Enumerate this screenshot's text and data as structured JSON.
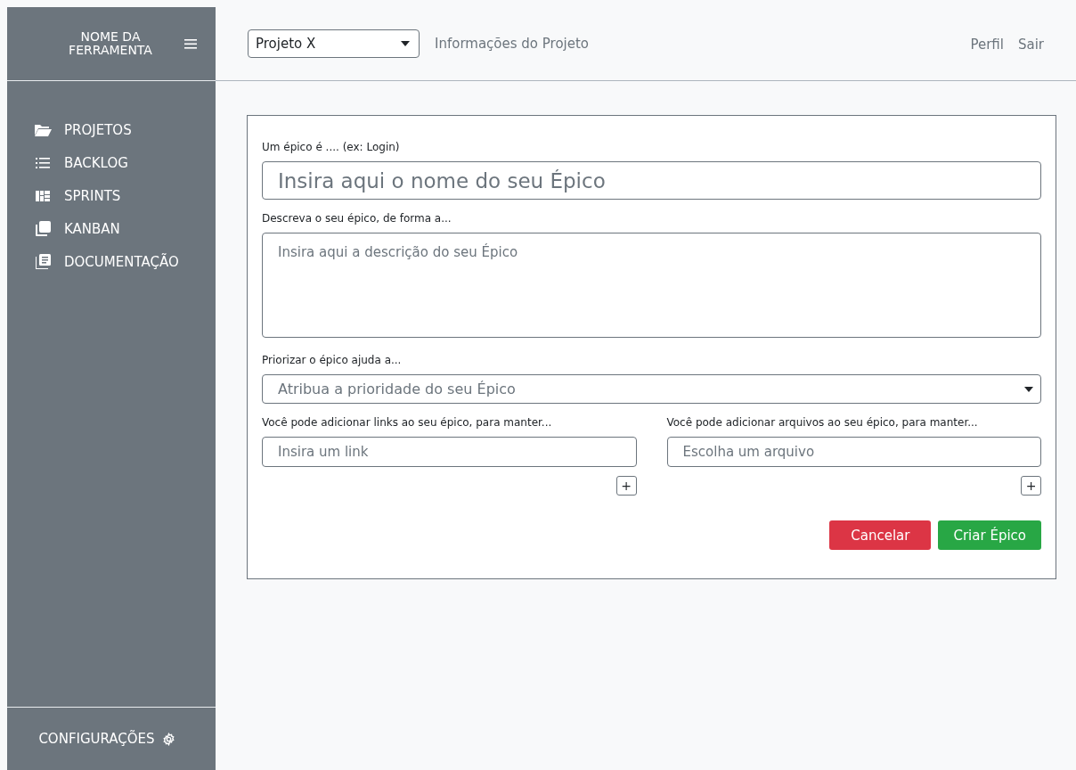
{
  "sidebar": {
    "brand": "NOME DA FERRAMENTA",
    "items": [
      {
        "label": "PROJETOS",
        "kind": "folder"
      },
      {
        "label": "BACKLOG",
        "kind": "list"
      },
      {
        "label": "SPRINTS",
        "kind": "grid"
      },
      {
        "label": "KANBAN",
        "kind": "stack"
      },
      {
        "label": "DOCUMENTAÇÃO",
        "kind": "doc"
      }
    ],
    "settings": "CONFIGURAÇÕES"
  },
  "header": {
    "project_select": "Projeto X",
    "project_info": "Informações do Projeto",
    "links": [
      "Perfil",
      "Sair"
    ]
  },
  "form": {
    "name_label": "Um épico é .... (ex: Login)",
    "name_placeholder": "Insira aqui o nome do seu Épico",
    "description_label": "Descreva o seu épico, de forma a...",
    "description_placeholder": "Insira aqui a descrição do seu Épico",
    "priority_label": "Priorizar o épico ajuda a...",
    "priority_placeholder": "Atribua a prioridade do seu Épico",
    "links_label": "Você pode adicionar links ao seu épico, para manter...",
    "links_placeholder": "Insira um link",
    "files_label": "Você pode adicionar arquivos ao seu épico, para manter...",
    "files_placeholder": "Escolha um arquivo",
    "add_buttons": [
      "+",
      "+"
    ],
    "cancel": "Cancelar",
    "submit": "Criar Épico"
  }
}
